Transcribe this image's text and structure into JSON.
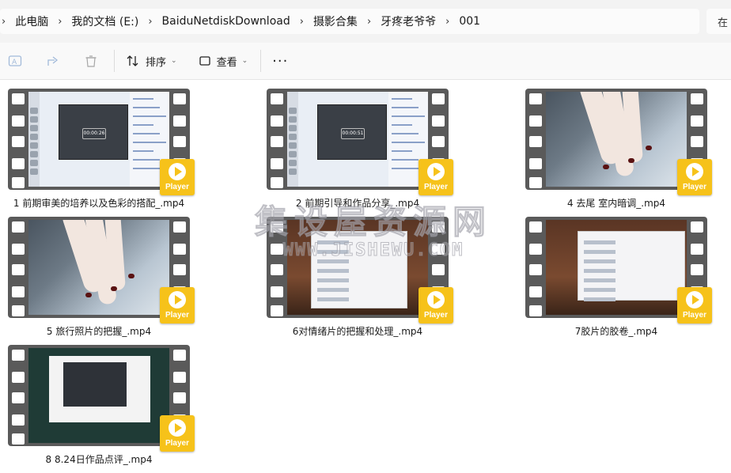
{
  "address_bar": {
    "crumbs": [
      "此电脑",
      "我的文档 (E:)",
      "BaiduNetdiskDownload",
      "摄影合集",
      "牙疼老爷爷",
      "001"
    ],
    "search_placeholder": "在"
  },
  "toolbar": {
    "sort_label": "排序",
    "view_label": "查看",
    "more_label": "···"
  },
  "player_label": "Player",
  "files": [
    {
      "name": "1 前期审美的培养以及色彩的搭配_.mp4",
      "timer": "00:00:26",
      "thumb": "chat"
    },
    {
      "name": "2 前期引导和作品分享_.mp4",
      "timer": "00:00:51",
      "thumb": "chat"
    },
    {
      "name": "4 去尾 室内暗调_.mp4",
      "thumb": "hand"
    },
    {
      "name": "5 旅行照片的把握_.mp4",
      "thumb": "hand"
    },
    {
      "name": "6对情绪片的把握和处理_.mp4",
      "thumb": "room"
    },
    {
      "name": "7胶片的胶卷_.mp4",
      "thumb": "room"
    },
    {
      "name": "8 8.24日作品点评_.mp4",
      "thumb": "dark"
    }
  ],
  "watermark": {
    "line1": "集设屋资源网",
    "line2": "WWW.JISHEWU.COM"
  }
}
